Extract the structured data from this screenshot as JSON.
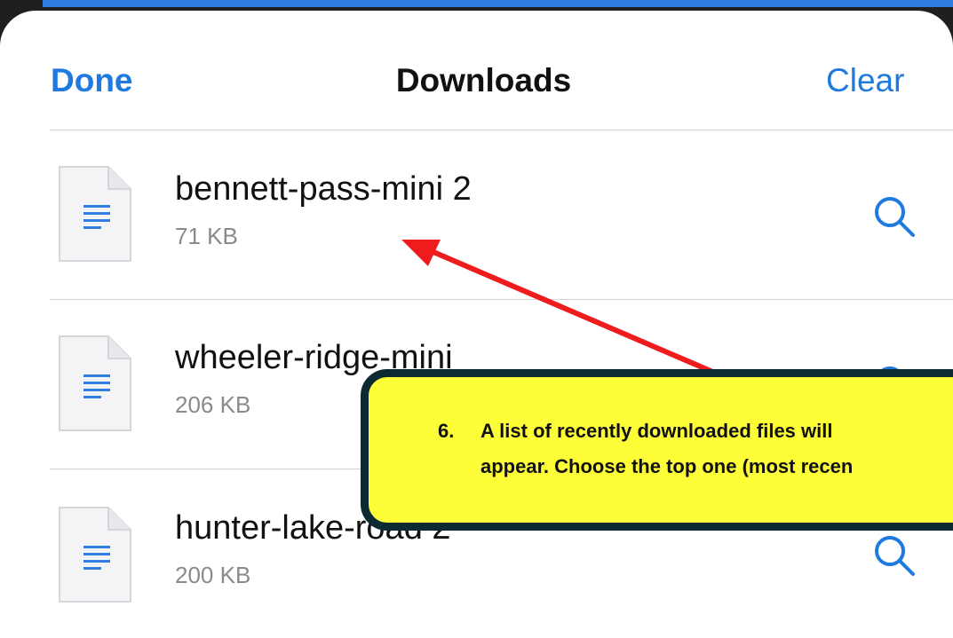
{
  "header": {
    "title": "Downloads",
    "done_label": "Done",
    "clear_label": "Clear"
  },
  "files": [
    {
      "name": "bennett-pass-mini 2",
      "size": "71 KB",
      "icon": "document-icon",
      "action_icon": "search-icon"
    },
    {
      "name": "wheeler-ridge-mini",
      "size": "206 KB",
      "icon": "document-icon",
      "action_icon": "search-icon"
    },
    {
      "name": "hunter-lake-road 2",
      "size": "200 KB",
      "icon": "document-icon",
      "action_icon": "search-icon"
    }
  ],
  "annotation": {
    "step_number": "6.",
    "line1": "A list of recently downloaded files will",
    "line2": "appear.  Choose the top one (most recen"
  },
  "colors": {
    "accent": "#1f7ae0",
    "callout_fill": "#fefe38",
    "callout_border": "#0d2a33",
    "arrow": "#ee1c1c"
  }
}
